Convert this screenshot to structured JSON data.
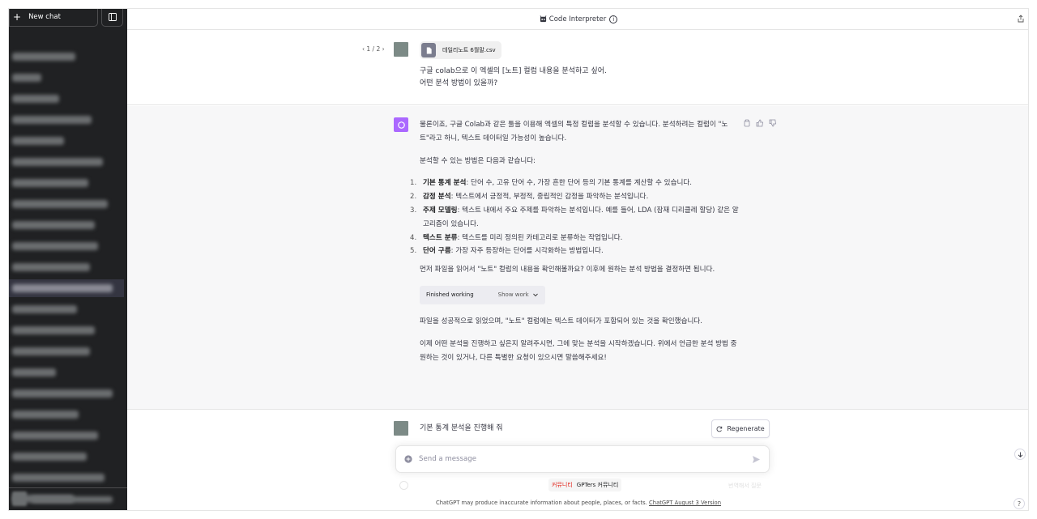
{
  "sidebar": {
    "new_chat_label": "New chat",
    "history_count": 23
  },
  "header": {
    "model_name": "Code Interpreter"
  },
  "conversation": {
    "first_user": {
      "pager": "1 / 2",
      "file_name": "데일리노트 6월말.csv",
      "text_line1": "구글 colab으로 이 엑셀의 [노트] 컬럼 내용을 분석하고 싶어.",
      "text_line2": "어떤 분석 방법이 있을까?"
    },
    "assistant": {
      "intro": "물론이죠, 구글 Colab과 같은 툴을 이용해 엑셀의 특정 컬럼을 분석할 수 있습니다. 분석하려는 컬럼이 \"노트\"라고 하니, 텍스트 데이터일 가능성이 높습니다.",
      "methods_intro": "분석할 수 있는 방법은 다음과 같습니다:",
      "methods": [
        {
          "num": "1.",
          "title": "기본 통계 분석",
          "desc": ": 단어 수, 고유 단어 수, 가장 흔한 단어 등의 기본 통계를 계산할 수 있습니다."
        },
        {
          "num": "2.",
          "title": "감정 분석",
          "desc": ": 텍스트에서 긍정적, 부정적, 중립적인 감정을 파악하는 분석입니다."
        },
        {
          "num": "3.",
          "title": "주제 모델링",
          "desc": ": 텍스트 내에서 주요 주제를 파악하는 분석입니다. 예를 들어, LDA (잠재 디리클레 할당) 같은 알고리즘이 있습니다."
        },
        {
          "num": "4.",
          "title": "텍스트 분류",
          "desc": ": 텍스트를 미리 정의된 카테고리로 분류하는 작업입니다."
        },
        {
          "num": "5.",
          "title": "단어 구름",
          "desc": ": 가장 자주 등장하는 단어를 시각화하는 방법입니다."
        }
      ],
      "question": "먼저 파일을 읽어서 \"노트\" 컬럼의 내용을 확인해볼까요? 이후에 원하는 분석 방법을 결정하면 됩니다.",
      "worked_label": "Finished working",
      "show_work_label": "Show work",
      "confirm": "파일을 성공적으로 읽었으며, \"노트\" 컬럼에는 텍스트 데이터가 포함되어 있는 것을 확인했습니다.",
      "closing": "이제 어떤 분석을 진행하고 싶은지 알려주시면, 그에 맞는 분석을 시작하겠습니다. 위에서 언급한 분석 방법 중 원하는 것이 있거나, 다른 특별한 요청이 있으시면 말씀해주세요!"
    },
    "second_user": {
      "text": "기본 통계 분석을 진행해 줘"
    }
  },
  "regenerate_label": "Regenerate",
  "composer": {
    "placeholder": "Send a message"
  },
  "community": {
    "tag": "커뮤니티",
    "name": "GPTers 커뮤니티"
  },
  "faint_text": "번역해서 질문",
  "footer": {
    "text": "ChatGPT may produce inaccurate information about people, places, or facts. ",
    "link": "ChatGPT August 3 Version"
  },
  "help_label": "?",
  "colors": {
    "sidebar_bg": "#202123",
    "assistant_avatar": "#ab68ff",
    "user_avatar": "#7c8a86",
    "assistant_bg": "#f7f7f8"
  }
}
